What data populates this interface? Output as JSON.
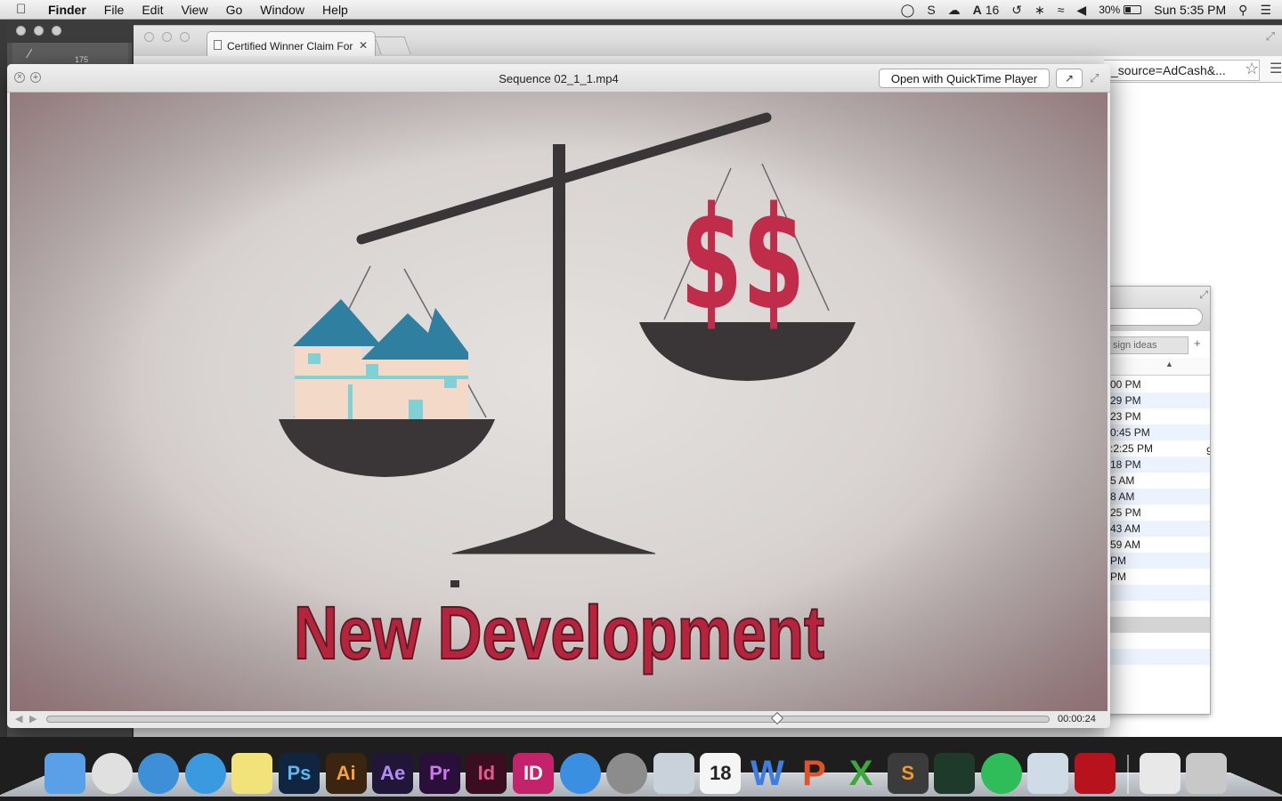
{
  "menubar": {
    "app": "Finder",
    "items": [
      "File",
      "Edit",
      "View",
      "Go",
      "Window",
      "Help"
    ],
    "adobe_count": "16",
    "battery": "30%",
    "clock": "Sun 5:35 PM"
  },
  "photoshop": {
    "brush_size": "175"
  },
  "chrome": {
    "tab_title": "Certified Winner Claim For",
    "url": "_source=AdCash&..."
  },
  "finder": {
    "tab_label": "sign ideas",
    "rows": [
      "00 PM",
      "29 PM",
      "23 PM",
      "0:45 PM",
      ":2:25 PM",
      "18 PM",
      "5 AM",
      "8 AM",
      "25 PM",
      "43 AM",
      "59 AM",
      "PM",
      "PM",
      "",
      "",
      "",
      "",
      "",
      ""
    ],
    "extra_mark": "9"
  },
  "quicklook": {
    "title": "Sequence 02_1_1.mp4",
    "open_button": "Open with QuickTime Player",
    "time": "00:00:24",
    "progress": 0.73
  },
  "video": {
    "caption": "New Development",
    "money_text": "$$",
    "colors": {
      "accent_red": "#b5243c",
      "roof_blue": "#2e7fa0",
      "scale_dark": "#3a3536"
    }
  },
  "dock": {
    "icons": [
      {
        "name": "finder-icon",
        "label": "",
        "color": "#5aa0e8"
      },
      {
        "name": "chrome-icon",
        "label": "",
        "color": "#e0e0e0"
      },
      {
        "name": "safari-icon",
        "label": "",
        "color": "#3d8fd8"
      },
      {
        "name": "itunes-icon",
        "label": "",
        "color": "#3a9ae0"
      },
      {
        "name": "stickies-icon",
        "label": "",
        "color": "#f2e27a"
      },
      {
        "name": "photoshop-icon",
        "label": "Ps",
        "color": "#0f2540"
      },
      {
        "name": "illustrator-icon",
        "label": "Ai",
        "color": "#3b2410"
      },
      {
        "name": "aftereffects-icon",
        "label": "Ae",
        "color": "#221638"
      },
      {
        "name": "premiere-icon",
        "label": "Pr",
        "color": "#2a0f3a"
      },
      {
        "name": "indesign-icon",
        "label": "Id",
        "color": "#3a0d1f"
      },
      {
        "name": "indesign-cs-icon",
        "label": "ID",
        "color": "#c2236a"
      },
      {
        "name": "app-store-icon",
        "label": "",
        "color": "#3b8fe0"
      },
      {
        "name": "system-preferences-icon",
        "label": "",
        "color": "#8c8c8c"
      },
      {
        "name": "mail-icon",
        "label": "",
        "color": "#c9d2db"
      },
      {
        "name": "calendar-icon",
        "label": "18",
        "color": "#f5f5f5"
      },
      {
        "name": "word-icon",
        "label": "W",
        "color": "transparent"
      },
      {
        "name": "powerpoint-icon",
        "label": "P",
        "color": "transparent"
      },
      {
        "name": "excel-icon",
        "label": "X",
        "color": "transparent"
      },
      {
        "name": "sublime-icon",
        "label": "S",
        "color": "#3b3b3b"
      },
      {
        "name": "activity-monitor-icon",
        "label": "",
        "color": "#1e3a2a"
      },
      {
        "name": "spotify-icon",
        "label": "",
        "color": "#2ebd59"
      },
      {
        "name": "preview-icon",
        "label": "",
        "color": "#cfdce8"
      },
      {
        "name": "flash-icon",
        "label": "",
        "color": "#b8121c"
      }
    ],
    "right_icons": [
      {
        "name": "document-icon",
        "color": "#e8e8e8"
      },
      {
        "name": "trash-icon",
        "color": "#c8c8c8"
      }
    ]
  }
}
